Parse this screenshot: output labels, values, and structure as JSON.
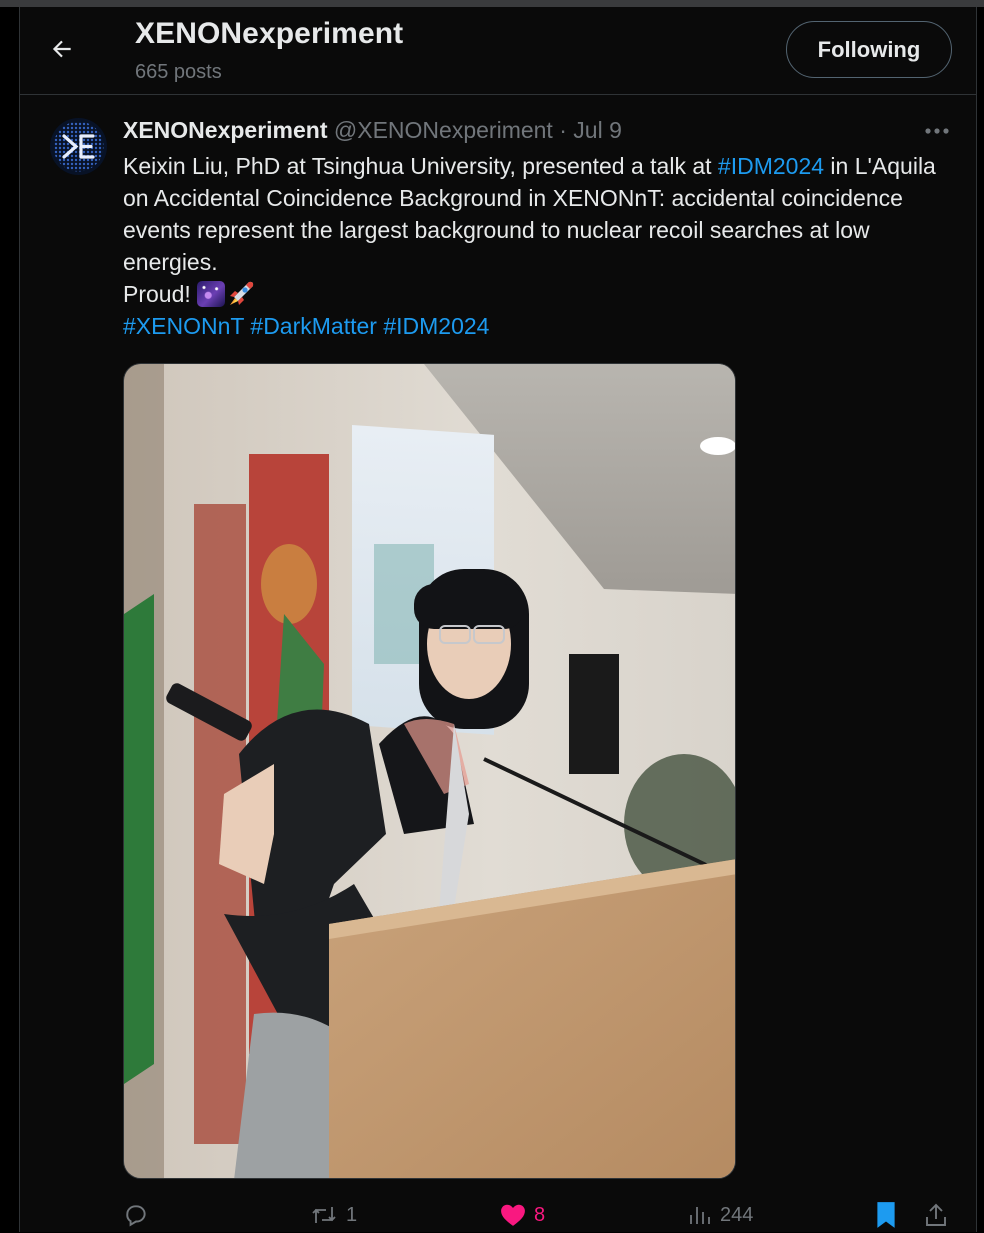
{
  "header": {
    "title": "XENONexperiment",
    "subtitle": "665 posts",
    "follow_label": "Following"
  },
  "tweet": {
    "display_name": "XENONexperiment",
    "handle": "@XENONexperiment",
    "separator": "·",
    "date": "Jul 9",
    "text": {
      "line1_pre": "Keixin Liu, PhD at Tsinghua University, presented a talk at ",
      "hashtag_inline": "#IDM2024",
      "line1_post": " in L'Aquila on Accidental Coincidence Background in XENONnT: accidental coincidence events represent the largest background to nuclear recoil searches at low energies.",
      "proud": "Proud! ",
      "emojis": [
        "milky-way",
        "rocket"
      ],
      "hashtags": [
        "#XENONnT",
        "#DarkMatter",
        "#IDM2024"
      ]
    },
    "media": {
      "image_icon": "photo-speaker-at-podium"
    },
    "actions": {
      "replies": "",
      "retweets": "1",
      "likes": "8",
      "views": "244"
    }
  },
  "colors": {
    "background": "#000000",
    "column": "#0a0a0a",
    "border": "#2f3336",
    "text": "#e7e9ea",
    "muted": "#71767b",
    "link": "#1d9bf0",
    "like": "#f91880",
    "bookmark": "#1d9bf0"
  },
  "icons": [
    "back-arrow-icon",
    "more-icon",
    "reply-icon",
    "retweet-icon",
    "heart-icon",
    "views-icon",
    "bookmark-icon",
    "share-icon"
  ]
}
